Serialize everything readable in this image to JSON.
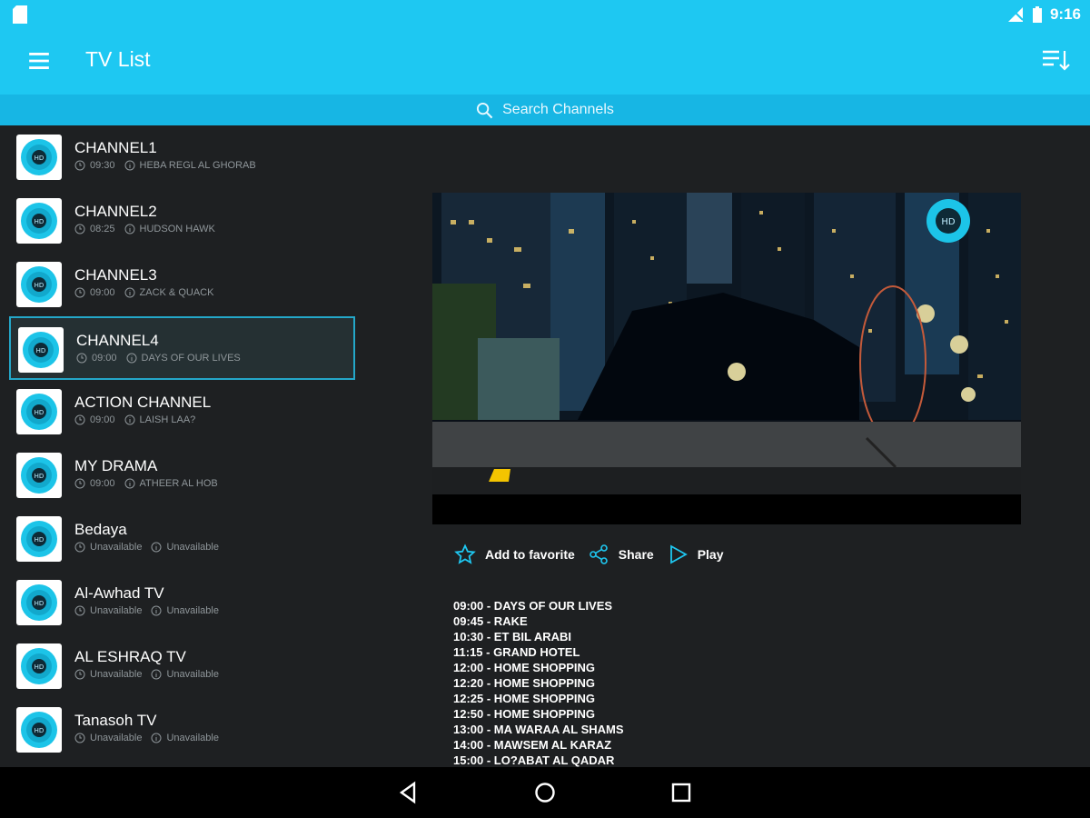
{
  "status_bar": {
    "time": "9:16"
  },
  "app_bar": {
    "title": "TV List"
  },
  "search": {
    "placeholder": "Search Channels"
  },
  "channels": [
    {
      "name": "CHANNEL1",
      "time": "09:30",
      "program": "HEBA REGL AL GHORAB"
    },
    {
      "name": "CHANNEL2",
      "time": "08:25",
      "program": "HUDSON HAWK"
    },
    {
      "name": "CHANNEL3",
      "time": "09:00",
      "program": "ZACK & QUACK"
    },
    {
      "name": "CHANNEL4",
      "time": "09:00",
      "program": "DAYS OF OUR LIVES"
    },
    {
      "name": "ACTION CHANNEL",
      "time": "09:00",
      "program": "LAISH LAA?"
    },
    {
      "name": "MY DRAMA",
      "time": "09:00",
      "program": "ATHEER AL HOB"
    },
    {
      "name": "Bedaya",
      "time": "Unavailable",
      "program": "Unavailable"
    },
    {
      "name": "Al-Awhad TV",
      "time": "Unavailable",
      "program": "Unavailable"
    },
    {
      "name": "AL ESHRAQ TV",
      "time": "Unavailable",
      "program": "Unavailable"
    },
    {
      "name": "Tanasoh TV",
      "time": "Unavailable",
      "program": "Unavailable"
    }
  ],
  "player": {
    "badge": "HD"
  },
  "actions": {
    "favorite": "Add to favorite",
    "share": "Share",
    "play": "Play"
  },
  "schedule": [
    "09:00 - DAYS OF OUR LIVES",
    "09:45 - RAKE",
    "10:30 - ET BIL ARABI",
    "11:15 - GRAND HOTEL",
    "12:00 - HOME SHOPPING",
    "12:20 - HOME SHOPPING",
    "12:25 - HOME SHOPPING",
    "12:50 - HOME SHOPPING",
    "13:00 - MA WARAA AL SHAMS",
    "14:00 - MAWSEM AL KARAZ",
    "15:00 - LO?ABAT AL QADAR"
  ],
  "colors": {
    "accent": "#1ec8f2",
    "background": "#1e2022",
    "selection_border": "#24a7c9"
  },
  "icons": {
    "menu": "menu-icon",
    "sort": "sort-icon",
    "search": "search-icon",
    "clock": "clock-icon",
    "info": "info-icon",
    "star": "star-icon",
    "share": "share-icon",
    "play": "play-icon"
  }
}
